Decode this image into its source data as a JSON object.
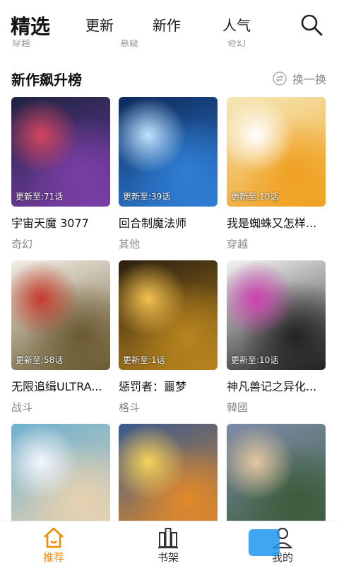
{
  "topnav": {
    "tabs": [
      "精选",
      "更新",
      "新作",
      "人气"
    ],
    "active_tab": "精选"
  },
  "section": {
    "title": "新作飙升榜",
    "refresh_label": "换一换"
  },
  "comics": [
    {
      "title": "宇宙天魔 3077",
      "genre": "奇幻",
      "update": "更新至:71话",
      "colors": [
        "#1b2340",
        "#7b3ea6",
        "#d6455f"
      ]
    },
    {
      "title": "回合制魔法师",
      "genre": "其他",
      "update": "更新至:39话",
      "colors": [
        "#0d2a5c",
        "#2f7fd6",
        "#bfe3ff"
      ]
    },
    {
      "title": "我是蜘蛛又怎样...",
      "genre": "穿越",
      "update": "更新至:10话",
      "colors": [
        "#f5e8b8",
        "#f0a020",
        "#ffffff"
      ]
    },
    {
      "title": "无限追缉ULTRA...",
      "genre": "战斗",
      "update": "更新至:58话",
      "colors": [
        "#f3efe6",
        "#6b5a32",
        "#c4392b"
      ]
    },
    {
      "title": "惩罚者：噩梦",
      "genre": "格斗",
      "update": "更新至:1话",
      "colors": [
        "#2a1f10",
        "#b8841e",
        "#f2c14e"
      ]
    },
    {
      "title": "神凡兽记之异化...",
      "genre": "韓國",
      "update": "更新至:10话",
      "colors": [
        "#f4f4f4",
        "#222222",
        "#cc3fb0"
      ]
    },
    {
      "title": "",
      "genre": "",
      "update": "",
      "colors": [
        "#6fb0cf",
        "#e8d2b0",
        "#f4f6ff"
      ]
    },
    {
      "title": "",
      "genre": "",
      "update": "",
      "colors": [
        "#3a5a8c",
        "#e0892a",
        "#f6d35a"
      ]
    },
    {
      "title": "",
      "genre": "",
      "update": "",
      "colors": [
        "#7d8ca8",
        "#3b5c3a",
        "#e4c7a0"
      ]
    }
  ],
  "bottomnav": {
    "items": [
      "推荐",
      "书架",
      "我的"
    ],
    "active": "推荐",
    "accent": "#f08c00"
  }
}
